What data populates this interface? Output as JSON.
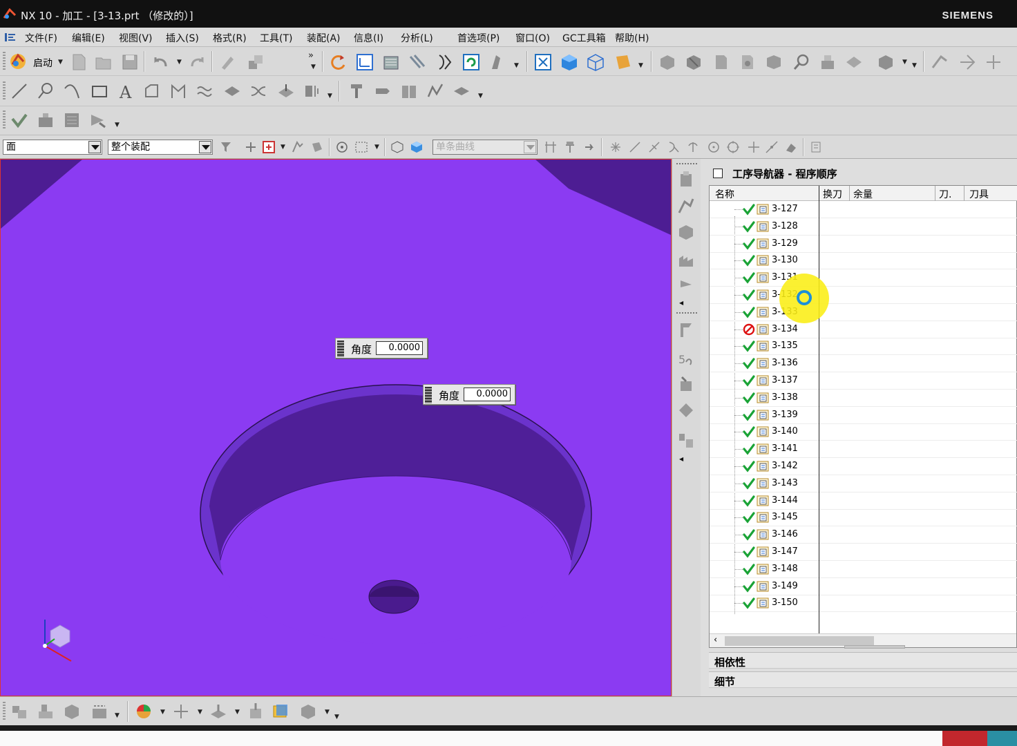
{
  "window": {
    "title": "NX 10 - 加工 - [3-13.prt （修改的）]",
    "brand": "SIEMENS"
  },
  "menu": {
    "items": [
      "文件(F)",
      "编辑(E)",
      "视图(V)",
      "插入(S)",
      "格式(R)",
      "工具(T)",
      "装配(A)",
      "信息(I)",
      "分析(L)",
      "首选项(P)",
      "窗口(O)",
      "GC工具箱",
      "帮助(H)"
    ]
  },
  "toolbar": {
    "start_label": "启动",
    "overflow": "»"
  },
  "selection_bar": {
    "type_filter": "面",
    "scope_filter": "整个装配",
    "curve_rule": "单条曲线"
  },
  "graphics": {
    "dynamic_inputs": [
      {
        "label": "角度",
        "value": "0.0000"
      },
      {
        "label": "角度",
        "value": "0.0000"
      }
    ],
    "colors": {
      "background": "#8b3bf2",
      "face_dark": "#4e1f95",
      "face_mid": "#6a2fc7"
    }
  },
  "navigator": {
    "title": "工序导航器 - 程序顺序",
    "columns": [
      "名称",
      "换刀",
      "余量",
      "刀.",
      "刀具"
    ],
    "rows": [
      {
        "name": "3-127",
        "status": "complete"
      },
      {
        "name": "3-128",
        "status": "complete"
      },
      {
        "name": "3-129",
        "status": "complete"
      },
      {
        "name": "3-130",
        "status": "complete"
      },
      {
        "name": "3-131",
        "status": "complete"
      },
      {
        "name": "3-132",
        "status": "complete"
      },
      {
        "name": "3-133",
        "status": "complete"
      },
      {
        "name": "3-134",
        "status": "regenerate"
      },
      {
        "name": "3-135",
        "status": "complete"
      },
      {
        "name": "3-136",
        "status": "complete"
      },
      {
        "name": "3-137",
        "status": "complete"
      },
      {
        "name": "3-138",
        "status": "complete"
      },
      {
        "name": "3-139",
        "status": "complete"
      },
      {
        "name": "3-140",
        "status": "complete"
      },
      {
        "name": "3-141",
        "status": "complete"
      },
      {
        "name": "3-142",
        "status": "complete"
      },
      {
        "name": "3-143",
        "status": "complete"
      },
      {
        "name": "3-144",
        "status": "complete"
      },
      {
        "name": "3-145",
        "status": "complete"
      },
      {
        "name": "3-146",
        "status": "complete"
      },
      {
        "name": "3-147",
        "status": "complete"
      },
      {
        "name": "3-148",
        "status": "complete"
      },
      {
        "name": "3-149",
        "status": "complete"
      },
      {
        "name": "3-150",
        "status": "complete"
      }
    ],
    "sections": [
      "相依性",
      "细节"
    ],
    "scroll_left": "‹"
  }
}
